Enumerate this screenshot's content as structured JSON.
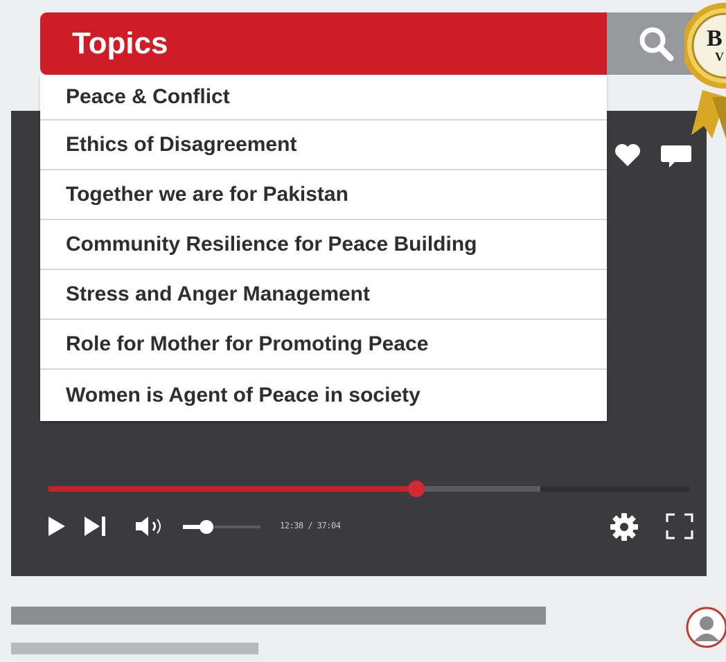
{
  "header": {
    "title": "Topics",
    "search_icon": "search-icon",
    "badge_text_line1": "B",
    "badge_text_line2": "V"
  },
  "menu": {
    "items": [
      {
        "label": "Peace & Conflict"
      },
      {
        "label": "Ethics of Disagreement"
      },
      {
        "label": "Together we are for Pakistan"
      },
      {
        "label": "Community Resilience for Peace Building"
      },
      {
        "label": "Stress and Anger Management"
      },
      {
        "label": "Role for Mother for Promoting Peace"
      },
      {
        "label": "Women is Agent of Peace in society"
      }
    ]
  },
  "player": {
    "time": "12:38 / 37:04",
    "progress_played_fraction": 0.57,
    "progress_buffered_fraction": 0.77,
    "volume_fraction": 0.3,
    "icons": [
      "heart-icon",
      "comment-icon",
      "play-icon",
      "skip-next-icon",
      "volume-icon",
      "settings-icon",
      "fullscreen-icon"
    ]
  },
  "colors": {
    "accent_red": "#cf1d27",
    "player_bg": "#3b3b3d",
    "search_bg": "#98999c",
    "badge_gold": "#d9a726"
  }
}
